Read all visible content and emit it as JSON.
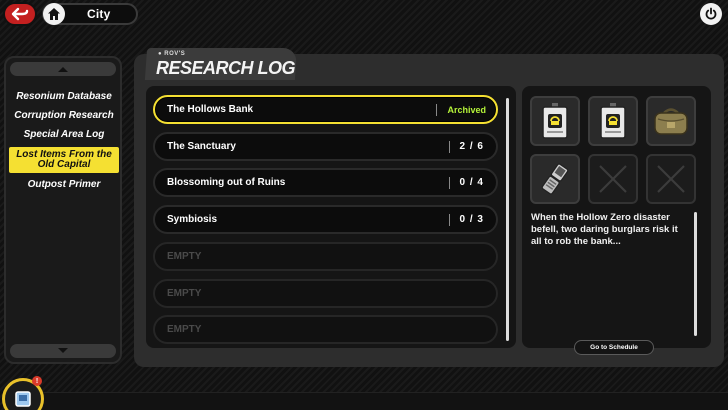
{
  "top_bar": {
    "location": "City",
    "back_icon": "back-arrow-icon",
    "home_icon": "home-icon",
    "power_icon": "power-icon"
  },
  "sidebar": {
    "items": [
      {
        "label": "Resonium Database",
        "active": false
      },
      {
        "label": "Corruption Research",
        "active": false
      },
      {
        "label": "Special Area Log",
        "active": false
      },
      {
        "label": "Lost Items From the Old Capital",
        "active": true
      },
      {
        "label": "Outpost Primer",
        "active": false
      }
    ]
  },
  "header": {
    "owner": "ROV'S",
    "title": "RESEARCH LOG"
  },
  "research_list": [
    {
      "title": "The Hollows Bank",
      "status": "Archived",
      "count": ""
    },
    {
      "title": "The Sanctuary",
      "status": "",
      "count": "2 / 6"
    },
    {
      "title": "Blossoming out of Ruins",
      "status": "",
      "count": "0 / 4"
    },
    {
      "title": "Symbiosis",
      "status": "",
      "count": "0 / 3"
    },
    {
      "title": "EMPTY",
      "status": "",
      "count": ""
    },
    {
      "title": "EMPTY",
      "status": "",
      "count": ""
    },
    {
      "title": "EMPTY",
      "status": "",
      "count": ""
    }
  ],
  "detail": {
    "items": [
      "id-badge-icon",
      "id-badge-icon",
      "duffel-bag-icon",
      "flip-phone-icon",
      "empty-slot-icon",
      "empty-slot-icon"
    ],
    "description": "When the Hollow Zero disaster befell, two daring burglars risk it all to rob the bank...",
    "schedule_button": "Go to Schedule"
  },
  "colors": {
    "accent": "#f5e032",
    "archived": "#b6f43a",
    "back": "#c42020"
  }
}
